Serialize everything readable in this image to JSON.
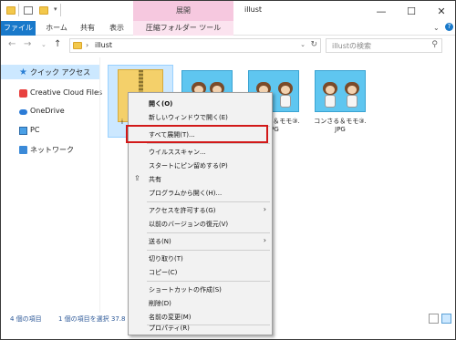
{
  "window": {
    "title": "illust",
    "context_tab_group": "展開",
    "minimize": "—",
    "maximize": "☐",
    "close": "✕"
  },
  "ribbon": {
    "tabs": [
      {
        "label": "ファイル"
      },
      {
        "label": "ホーム"
      },
      {
        "label": "共有"
      },
      {
        "label": "表示"
      },
      {
        "label": "圧縮フォルダー ツール"
      }
    ]
  },
  "address": {
    "path": "illust",
    "search_placeholder": "illustの検索"
  },
  "nav": {
    "items": [
      {
        "label": "クイック アクセス",
        "icon": "star-icon"
      },
      {
        "label": "Creative Cloud Files",
        "icon": "creative-cloud-icon"
      },
      {
        "label": "OneDrive",
        "icon": "cloud-icon"
      },
      {
        "label": "PC",
        "icon": "pc-icon"
      },
      {
        "label": "ネットワーク",
        "icon": "network-icon"
      }
    ]
  },
  "files": [
    {
      "caption": "i",
      "type": "zip"
    },
    {
      "caption": "",
      "type": "image"
    },
    {
      "caption": "コンさる＆モモ③.\nJPG",
      "type": "image"
    },
    {
      "caption": "コンさる＆モモ③.\nJPG",
      "type": "image"
    }
  ],
  "status": {
    "count": "4 個の項目",
    "selected": "1 個の項目を選択  37.8"
  },
  "context_menu": {
    "items": [
      {
        "label": "開く(O)",
        "bold": true
      },
      {
        "label": "新しいウィンドウで開く(E)"
      },
      {
        "label": "すべて展開(T)...",
        "highlighted": true
      },
      {
        "label": "ウイルススキャン..."
      },
      {
        "label": "スタートにピン留めする(P)"
      },
      {
        "label": "共有"
      },
      {
        "label": "プログラムから開く(H)..."
      },
      {
        "label": "アクセスを許可する(G)",
        "submenu": true
      },
      {
        "label": "以前のバージョンの復元(V)"
      },
      {
        "label": "送る(N)",
        "submenu": true
      },
      {
        "label": "切り取り(T)"
      },
      {
        "label": "コピー(C)"
      },
      {
        "label": "ショートカットの作成(S)"
      },
      {
        "label": "削除(D)"
      },
      {
        "label": "名前の変更(M)"
      },
      {
        "label": "プロパティ(R)"
      }
    ]
  },
  "colors": {
    "file_tab": "#1979ca",
    "context_tab": "#f6c8df",
    "selection": "#cce8ff",
    "highlight_box": "#d21919"
  }
}
